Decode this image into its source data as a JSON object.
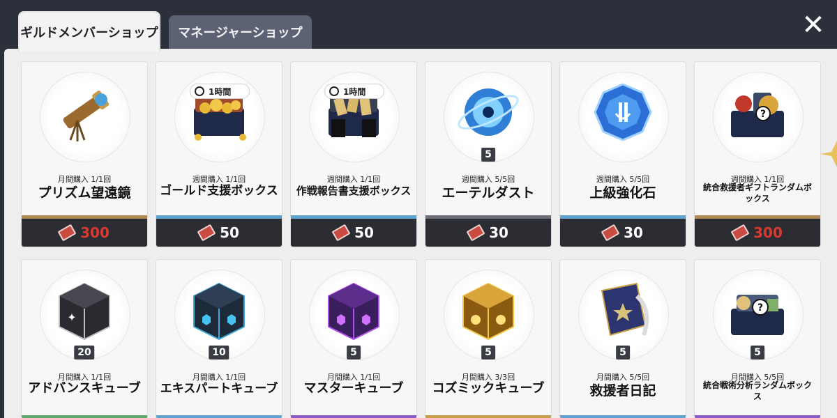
{
  "tabs": [
    {
      "label": "ギルドメンバーショップ"
    },
    {
      "label": "マネージャーショップ"
    }
  ],
  "close_label": "✕",
  "items": [
    {
      "icon": "telescope-icon",
      "limit": "月間購入 1/1回",
      "name": "プリズム望遠鏡",
      "price": "300",
      "price_color": "#d83a32",
      "stripe": "#b08a55",
      "qty": "",
      "timer": ""
    },
    {
      "icon": "gold-chest-icon",
      "limit": "週間購入 1/1回",
      "name": "ゴールド支援ボックス",
      "price": "50",
      "price_color": "#ffffff",
      "stripe": "#5fa3d1",
      "qty": "",
      "timer": "1時間"
    },
    {
      "icon": "report-chest-icon",
      "limit": "週間購入 1/1回",
      "name": "作戦報告書支援ボックス",
      "price": "50",
      "price_color": "#ffffff",
      "stripe": "#5fa3d1",
      "qty": "",
      "timer": "1時間"
    },
    {
      "icon": "ether-dust-icon",
      "limit": "週間購入 5/5回",
      "name": "エーテルダスト",
      "price": "30",
      "price_color": "#ffffff",
      "stripe": "#6c6f78",
      "qty": "5",
      "timer": ""
    },
    {
      "icon": "enhance-stone-icon",
      "limit": "週間購入 5/5回",
      "name": "上級強化石",
      "price": "30",
      "price_color": "#ffffff",
      "stripe": "#5fa3d1",
      "qty": "",
      "timer": ""
    },
    {
      "icon": "random-gift-box-icon",
      "limit": "週間購入 1/1回",
      "name": "統合救援者ギフトランダムボックス",
      "price": "300",
      "price_color": "#d83a32",
      "stripe": "#b08a55",
      "qty": "",
      "timer": ""
    },
    {
      "icon": "advanced-cube-icon",
      "limit": "月間購入 1/1回",
      "name": "アドバンスキューブ",
      "stripe": "#5da86a",
      "qty": "20"
    },
    {
      "icon": "expert-cube-icon",
      "limit": "月間購入 1/1回",
      "name": "エキスパートキューブ",
      "stripe": "#5fa3d1",
      "qty": "10"
    },
    {
      "icon": "master-cube-icon",
      "limit": "月間購入 1/1回",
      "name": "マスターキューブ",
      "stripe": "#8b5cc9",
      "qty": "5"
    },
    {
      "icon": "cosmic-cube-icon",
      "limit": "月間購入 3/3回",
      "name": "コズミックキューブ",
      "stripe": "#c9a049",
      "qty": "5"
    },
    {
      "icon": "rescuer-diary-icon",
      "limit": "月間購入 5/5回",
      "name": "救援者日記",
      "stripe": "#5fa3d1",
      "qty": "5"
    },
    {
      "icon": "tactics-random-box-icon",
      "limit": "月間購入 5/5回",
      "name": "統合戦術分析ランダムボックス",
      "stripe": "#8b5cc9",
      "qty": "5"
    }
  ]
}
